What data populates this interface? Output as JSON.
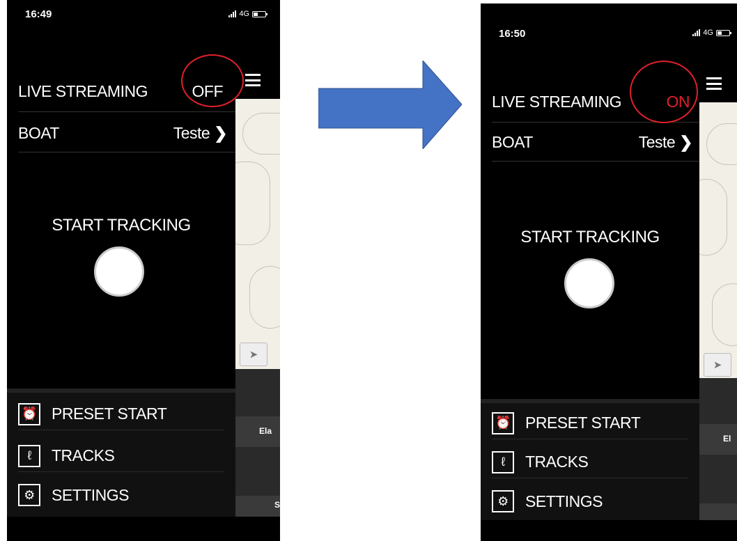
{
  "before": {
    "status_time": "16:49",
    "network": "4G",
    "live_streaming_label": "LIVE STREAMING",
    "live_streaming_value": "OFF",
    "boat_label": "BOAT",
    "boat_value": "Teste",
    "start_tracking_label": "START TRACKING",
    "menu_items": [
      {
        "label": "PRESET START",
        "icon": "alarm-clock-icon"
      },
      {
        "label": "TRACKS",
        "icon": "track-path-icon"
      },
      {
        "label": "SETTINGS",
        "icon": "gear-icon"
      }
    ],
    "map_band_text": "Ela",
    "map_band_text_2": "S"
  },
  "after": {
    "status_time": "16:50",
    "network": "4G",
    "live_streaming_label": "LIVE STREAMING",
    "live_streaming_value": "ON",
    "boat_label": "BOAT",
    "boat_value": "Teste",
    "start_tracking_label": "START TRACKING",
    "menu_items": [
      {
        "label": "PRESET START",
        "icon": "alarm-clock-icon"
      },
      {
        "label": "TRACKS",
        "icon": "track-path-icon"
      },
      {
        "label": "SETTINGS",
        "icon": "gear-icon"
      }
    ],
    "map_band_text": "El"
  },
  "colors": {
    "on_value": "#e0202a",
    "off_value": "#ffffff",
    "arrow_fill": "#4472c4",
    "annotation": "#e0202a"
  }
}
